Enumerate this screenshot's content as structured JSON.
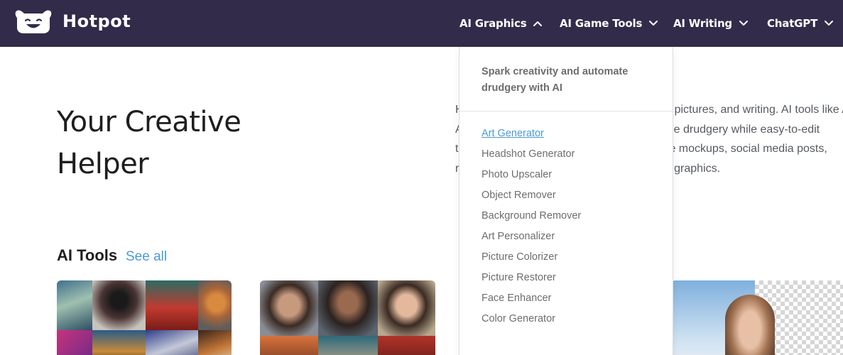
{
  "brand": {
    "name": "Hotpot",
    "logo_icon": "smiling-face-logo"
  },
  "nav": {
    "items": [
      {
        "label": "AI Graphics",
        "icon": "chevron-up-icon",
        "expanded": true
      },
      {
        "label": "AI Game Tools",
        "icon": "chevron-down-icon",
        "expanded": false
      },
      {
        "label": "AI Writing",
        "icon": "chevron-down-icon",
        "expanded": false
      },
      {
        "label": "ChatGPT",
        "icon": "chevron-down-icon",
        "expanded": false
      }
    ]
  },
  "hero": {
    "title_line1": "Your Creative",
    "title_line2": "Helper",
    "description_lines": [
      "H",
      "A",
      "t",
      "r"
    ],
    "description_right_lines": [
      "pictures, and writing. AI tools like A",
      "e drudgery while easy-to-edit",
      "e mockups, social media posts,",
      "rk graphics."
    ]
  },
  "tools": {
    "heading": "AI Tools",
    "see_all": "See all"
  },
  "dropdown": {
    "intro": "Spark creativity and automate drudgery with AI",
    "items": [
      "Art Generator",
      "Headshot Generator",
      "Photo Upscaler",
      "Object Remover",
      "Background Remover",
      "Art Personalizer",
      "Picture Colorizer",
      "Picture Restorer",
      "Face Enhancer",
      "Color Generator"
    ],
    "active_index": 0
  },
  "colors": {
    "navbar": "#332b4a",
    "accent_link": "#4c9ad4",
    "body_text": "#1e1e1e",
    "muted_text": "#6d6d6d"
  }
}
